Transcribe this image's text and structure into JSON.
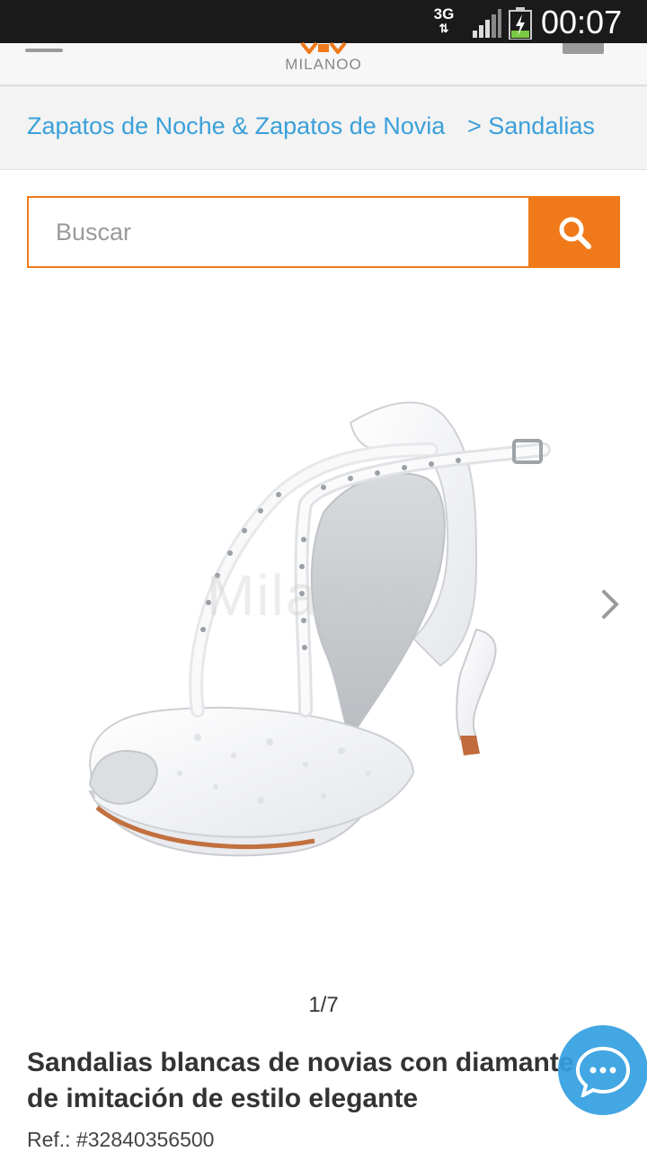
{
  "status_bar": {
    "network": "3G",
    "time": "00:07"
  },
  "header": {
    "brand": "MILANOO"
  },
  "breadcrumb": {
    "category": "Zapatos de Noche & Zapatos de Novia",
    "subcategory": "> Sandalias"
  },
  "search": {
    "placeholder": "Buscar"
  },
  "gallery": {
    "watermark": "Milanoo",
    "counter": "1/7"
  },
  "product": {
    "title": "Sandalias blancas de novias con diamante de imitación de estilo elegante",
    "ref_label": "Ref.:",
    "ref_value": "#32840356500"
  },
  "colors": {
    "accent": "#f07a1a",
    "link": "#3ba0da",
    "chat": "#32a0e1"
  },
  "icons": {
    "search": "search-icon",
    "next": "chevron-right-icon",
    "chat": "chat-bubble-icon",
    "menu": "menu-icon",
    "cart": "bag-icon"
  }
}
